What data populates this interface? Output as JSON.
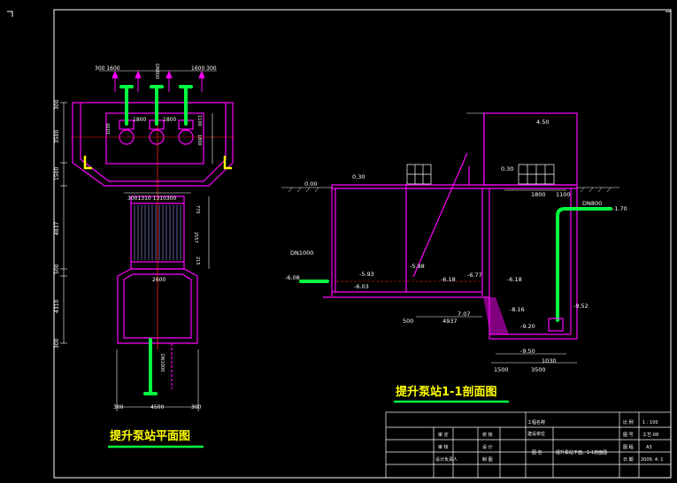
{
  "plan": {
    "title": "提升泵站平面图",
    "dims": {
      "top_left": "300 1600",
      "top_right": "1600 300",
      "pipe_dn_label": "DN800",
      "side_300": "300",
      "side_3500": "3500",
      "side_1500": "1500",
      "side_4837": "4837",
      "side_500": "500",
      "side_4310": "4310",
      "side_300b": "300",
      "inner_1030": "1030",
      "inner_1800a": "1800",
      "inner_1800b": "1800",
      "right_1100": "1100",
      "right_1800": "1800",
      "right_770": "770",
      "right_2557": "2557",
      "right_215": "215",
      "mid_dims": "3001310  1310300",
      "mid_2600": "2600",
      "bottom_300a": "300",
      "bottom_4500": "4500",
      "bottom_300b": "300",
      "inlet_text": "DN1000"
    }
  },
  "section": {
    "title": "提升泵站1-1剖面图",
    "labels": {
      "top_450": "4.50",
      "el_030a": "0.30",
      "el_000": "0.00",
      "el_030b": "0.30",
      "d_1800": "1800",
      "d_1100": "1100",
      "dn800": "DN800",
      "el_170": "-1.70",
      "inlet_dn": "DN1000",
      "el_608": "-6.08",
      "el_593": "-5.93",
      "el_603": "-6.03",
      "el_598": "-5.98",
      "el_618": "-6.18",
      "el_677": "-6.77",
      "el_618b": "-6.18",
      "el_816": "-8.16",
      "el_920": "-9.20",
      "el_952": "-9.52",
      "el_950": "-9.50",
      "d_500": "500",
      "d_4937": "4937",
      "d_707": "7.07",
      "d_1500": "1500",
      "d_1030": "1030",
      "d_3500": "3500"
    }
  },
  "title_block": {
    "rows": [
      [
        "审 定",
        "",
        "校 核",
        "",
        "",
        "",
        "",
        "比 例",
        "1 : 100"
      ],
      [
        "审 核",
        "",
        "设 计",
        "",
        "图 名",
        "提升泵站平面、1-1剖面图",
        "",
        "图 号",
        "工艺-08"
      ],
      [
        "设计负责人",
        "",
        "制 图",
        "",
        "",
        "",
        "",
        "图 幅",
        "A3"
      ],
      [
        "",
        "",
        "",
        "",
        "",
        "",
        "",
        "日 期",
        "2009. 4. 1"
      ]
    ],
    "project_label": "工程名称",
    "project_sub": "建设单位"
  }
}
